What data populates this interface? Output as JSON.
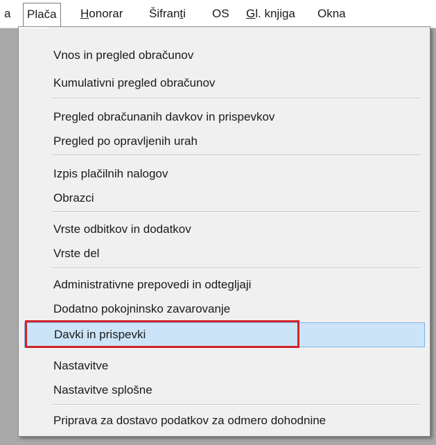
{
  "menubar": {
    "items": [
      {
        "label": "a"
      },
      {
        "label": "Plača"
      },
      {
        "label": "Honorar",
        "mnemonic": "H",
        "rest": "onorar"
      },
      {
        "label": "Šifranti",
        "pre": "Šifran",
        "mnemonic": "t",
        "rest": "i"
      },
      {
        "label": "OS"
      },
      {
        "label": "Gl. knjiga",
        "mnemonic": "G",
        "rest": "l. knjiga"
      },
      {
        "label": "Okna"
      }
    ]
  },
  "dropdown": {
    "items": [
      "Vnos in pregled obračunov",
      "Kumulativni pregled obračunov",
      "Pregled obračunanih davkov in prispevkov",
      "Pregled po opravljenih urah",
      "Izpis plačilnih nalogov",
      "Obrazci",
      "Vrste odbitkov in dodatkov",
      "Vrste del",
      "Administrativne prepovedi in odtegljaji",
      "Dodatno pokojninsko zavarovanje",
      "Davki in prispevki",
      "Nastavitve",
      "Nastavitve splošne",
      "Priprava za dostavo podatkov za odmero dohodnine"
    ],
    "selected_item": "Davki in prispevki"
  },
  "colors": {
    "selection_bg": "#cce4f7",
    "selection_border": "#7fb4e3",
    "annotation_red": "#d2232a",
    "background": "#a9a9a9"
  }
}
